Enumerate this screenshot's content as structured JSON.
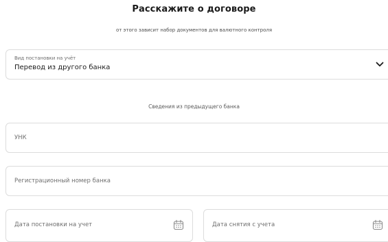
{
  "header": {
    "title": "Расскажите о договоре",
    "subtitle": "от этого зависит набор документов для валютного контроля"
  },
  "registration_type": {
    "label": "Вид постановки на учёт",
    "value": "Перевод из другого банка",
    "icon": "chevron-down-icon"
  },
  "previous_bank": {
    "caption": "Сведения из предыдущего банка",
    "unk_placeholder": "УНК",
    "bank_reg_number_placeholder": "Регистрационный номер банка",
    "registration_date_placeholder": "Дата постановки на учет",
    "deregistration_date_placeholder": "Дата снятия с учета",
    "date_icon": "calendar-icon"
  },
  "colors": {
    "border": "#dcdcdc",
    "text": "#1a1a1a",
    "muted": "#6e6e6e"
  }
}
